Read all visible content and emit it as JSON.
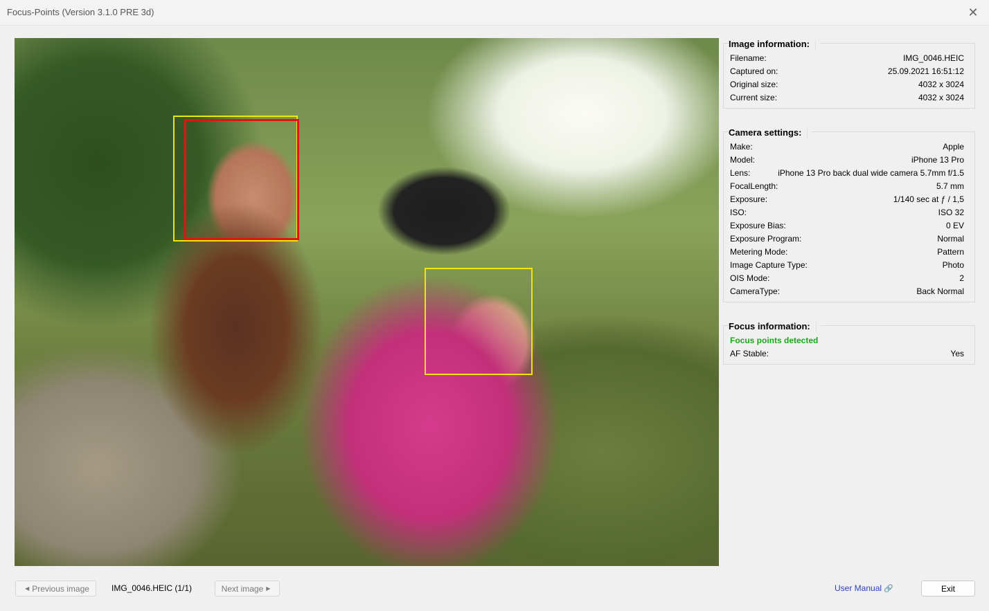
{
  "window": {
    "title": "Focus-Points (Version 3.1.0 PRE 3d)",
    "close_glyph": "✕"
  },
  "image_info": {
    "heading": "Image information:",
    "rows": [
      {
        "label": "Filename:",
        "value": "IMG_0046.HEIC"
      },
      {
        "label": "Captured on:",
        "value": "25.09.2021 16:51:12"
      },
      {
        "label": "Original size:",
        "value": "4032 x 3024"
      },
      {
        "label": "Current size:",
        "value": "4032 x 3024"
      }
    ]
  },
  "camera_settings": {
    "heading": "Camera settings:",
    "rows": [
      {
        "label": "Make:",
        "value": "Apple"
      },
      {
        "label": "Model:",
        "value": "iPhone 13 Pro"
      },
      {
        "label": "Lens:",
        "value": "iPhone 13 Pro back dual wide camera 5.7mm f/1.5"
      },
      {
        "label": "FocalLength:",
        "value": "5.7 mm"
      },
      {
        "label": "Exposure:",
        "value": "1/140 sec at ƒ / 1,5"
      },
      {
        "label": "ISO:",
        "value": "ISO 32"
      },
      {
        "label": "Exposure Bias:",
        "value": "0 EV"
      },
      {
        "label": "Exposure Program:",
        "value": "Normal"
      },
      {
        "label": "Metering Mode:",
        "value": "Pattern"
      },
      {
        "label": "Image Capture Type:",
        "value": "Photo"
      },
      {
        "label": "OIS Mode:",
        "value": "2"
      },
      {
        "label": "CameraType:",
        "value": "Back Normal"
      }
    ]
  },
  "focus_info": {
    "heading": "Focus information:",
    "status": "Focus points detected",
    "rows": [
      {
        "label": "AF Stable:",
        "value": "Yes"
      }
    ]
  },
  "footer": {
    "prev_label": "Previous image",
    "prev_glyph": "◀",
    "current": "IMG_0046.HEIC (1/1)",
    "next_label": "Next image",
    "next_glyph": "▶",
    "manual_label": "User Manual",
    "manual_icon": "🔗",
    "exit_label": "Exit"
  },
  "colors": {
    "focus_frame_yellow": "#f0e60c",
    "focus_frame_red": "#e01414",
    "status_ok": "#1ea51e",
    "link": "#2a3fb8"
  }
}
